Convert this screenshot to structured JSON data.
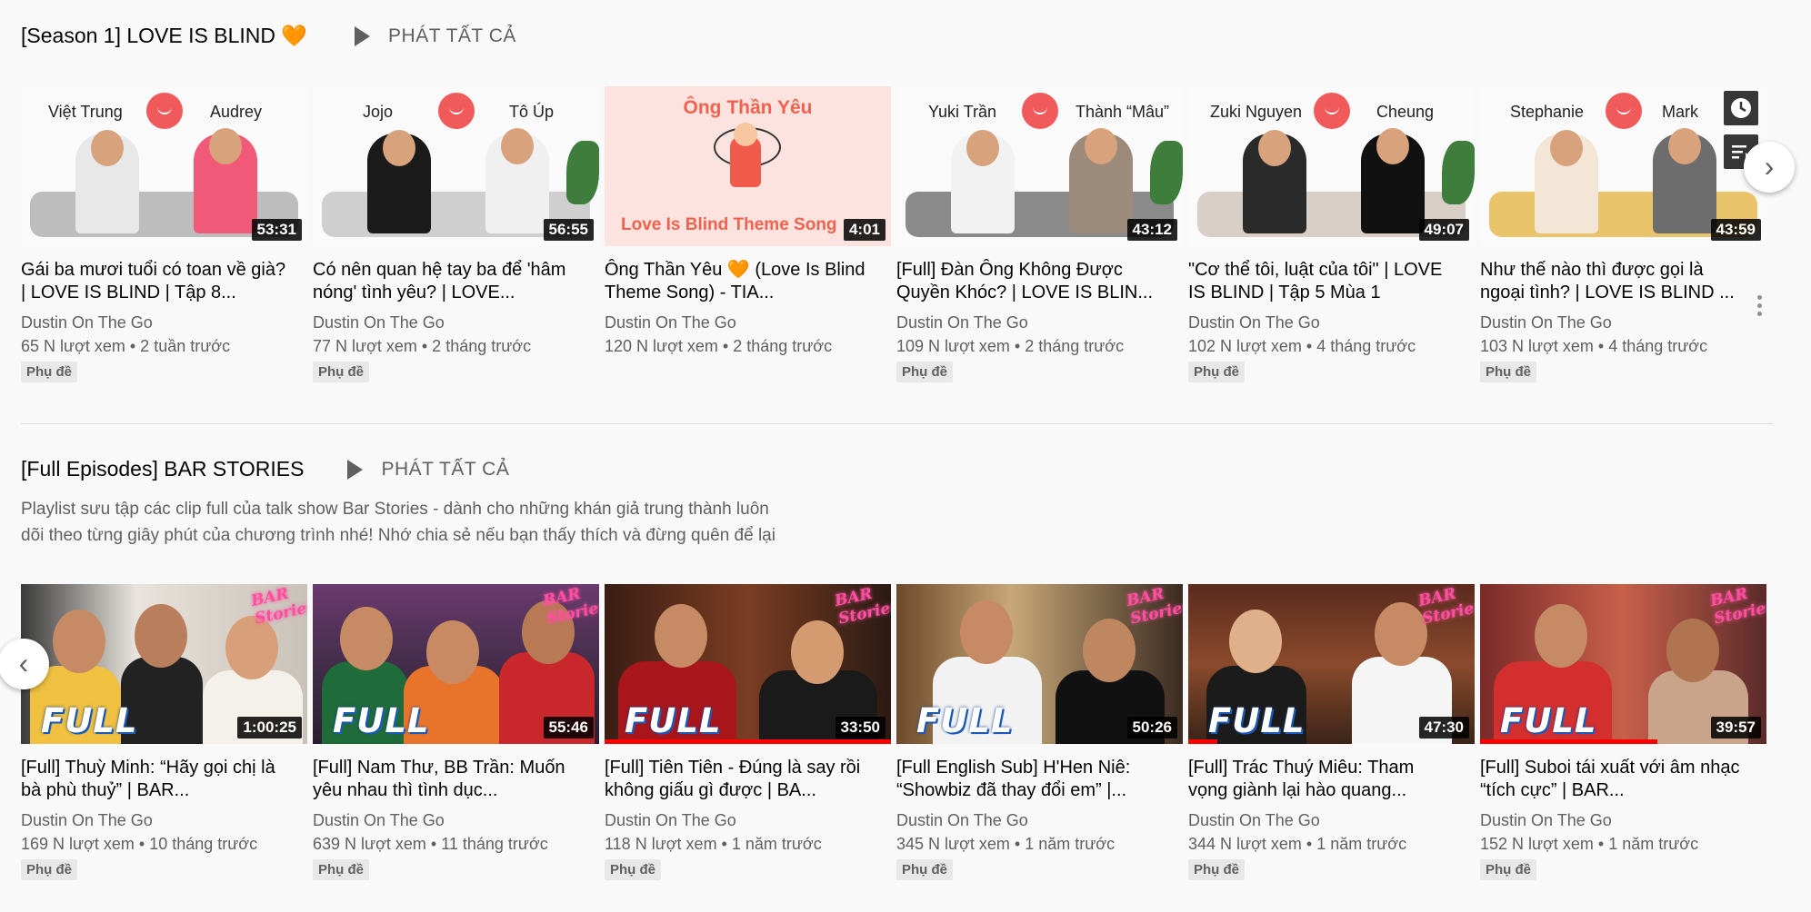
{
  "shelf1": {
    "title": "[Season 1] LOVE IS BLIND 🧡",
    "play_all": "PHÁT TẤT CẢ",
    "videos": [
      {
        "title": "Gái ba mươi tuổi có toan về già? | LOVE IS BLIND | Tập 8...",
        "channel": "Dustin On The Go",
        "meta": "65 N lượt xem • 2 tuần trước",
        "badge": "Phụ đề",
        "duration": "53:31",
        "name_left": "Việt Trung",
        "name_right": "Audrey"
      },
      {
        "title": "Có nên quan hệ tay ba để 'hâm nóng' tình yêu? | LOVE...",
        "channel": "Dustin On The Go",
        "meta": "77 N lượt xem • 2 tháng trước",
        "badge": "Phụ đề",
        "duration": "56:55",
        "name_left": "Jojo",
        "name_right": "Tô Úp"
      },
      {
        "title": "Ông Thần Yêu 🧡 (Love Is Blind Theme Song) - TIA...",
        "channel": "Dustin On The Go",
        "meta": "120 N lượt xem • 2 tháng trước",
        "badge": "",
        "duration": "4:01",
        "thumb_top": "Ông Thần Yêu",
        "thumb_bottom": "Love Is Blind Theme Song"
      },
      {
        "title": "[Full] Đàn Ông Không Được Quyền Khóc? | LOVE IS BLIN...",
        "channel": "Dustin On The Go",
        "meta": "109 N lượt xem • 2 tháng trước",
        "badge": "Phụ đề",
        "duration": "43:12",
        "name_left": "Yuki Trần",
        "name_right": "Thành “Mâu”"
      },
      {
        "title": "\"Cơ thể tôi, luật của tôi\" | LOVE IS BLIND | Tập 5 Mùa 1",
        "channel": "Dustin On The Go",
        "meta": "102 N lượt xem • 4 tháng trước",
        "badge": "Phụ đề",
        "duration": "49:07",
        "name_left": "Zuki Nguyen",
        "name_right": "Cheung"
      },
      {
        "title": "Như thế nào thì được gọi là ngoại tình? | LOVE IS BLIND ...",
        "channel": "Dustin On The Go",
        "meta": "103 N lượt xem • 4 tháng trước",
        "badge": "Phụ đề",
        "duration": "43:59",
        "name_left": "Stephanie",
        "name_right": "Mark"
      }
    ]
  },
  "shelf2": {
    "title": "[Full Episodes] BAR STORIES",
    "play_all": "PHÁT TẤT CẢ",
    "description_line1": "Playlist sưu tập các clip full của talk show Bar Stories - dành cho những khán giả trung thành luôn",
    "description_line2": "dõi theo từng giây phút của chương trình nhé! Nhớ chia sẻ nếu bạn thấy thích và đừng quên để lại",
    "thumb_label": "FULL",
    "neon_label": "BAR Stories",
    "videos": [
      {
        "title": "[Full] Thuỳ Minh: “Hãy gọi chị là bà phù thuỷ” | BAR...",
        "channel": "Dustin On The Go",
        "meta": "169 N lượt xem • 10 tháng trước",
        "badge": "Phụ đề",
        "duration": "1:00:25",
        "progress": 0
      },
      {
        "title": "[Full] Nam Thư, BB Trần: Muốn yêu nhau thì tình dục...",
        "channel": "Dustin On The Go",
        "meta": "639 N lượt xem • 11 tháng trước",
        "badge": "Phụ đề",
        "duration": "55:46",
        "progress": 0
      },
      {
        "title": "[Full] Tiên Tiên - Đúng là say rồi không giấu gì được | BA...",
        "channel": "Dustin On The Go",
        "meta": "118 N lượt xem • 1 năm trước",
        "badge": "Phụ đề",
        "duration": "33:50",
        "progress": 100
      },
      {
        "title": "[Full English Sub] H'Hen Niê: “Showbiz đã thay đổi em” |...",
        "channel": "Dustin On The Go",
        "meta": "345 N lượt xem • 1 năm trước",
        "badge": "Phụ đề",
        "duration": "50:26",
        "progress": 0
      },
      {
        "title": "[Full] Trác Thuý Miêu: Tham vọng giành lại hào quang...",
        "channel": "Dustin On The Go",
        "meta": "344 N lượt xem • 1 năm trước",
        "badge": "Phụ đề",
        "duration": "47:30",
        "progress": 10
      },
      {
        "title": "[Full] Suboi tái xuất với âm nhạc “tích cực” | BAR...",
        "channel": "Dustin On The Go",
        "meta": "152 N lượt xem • 1 năm trước",
        "badge": "Phụ đề",
        "duration": "39:57",
        "progress": 62
      }
    ]
  },
  "icons": {
    "next_arrow": "›",
    "prev_arrow": "‹",
    "watch_later": "clock-icon",
    "add_queue": "queue-icon"
  }
}
